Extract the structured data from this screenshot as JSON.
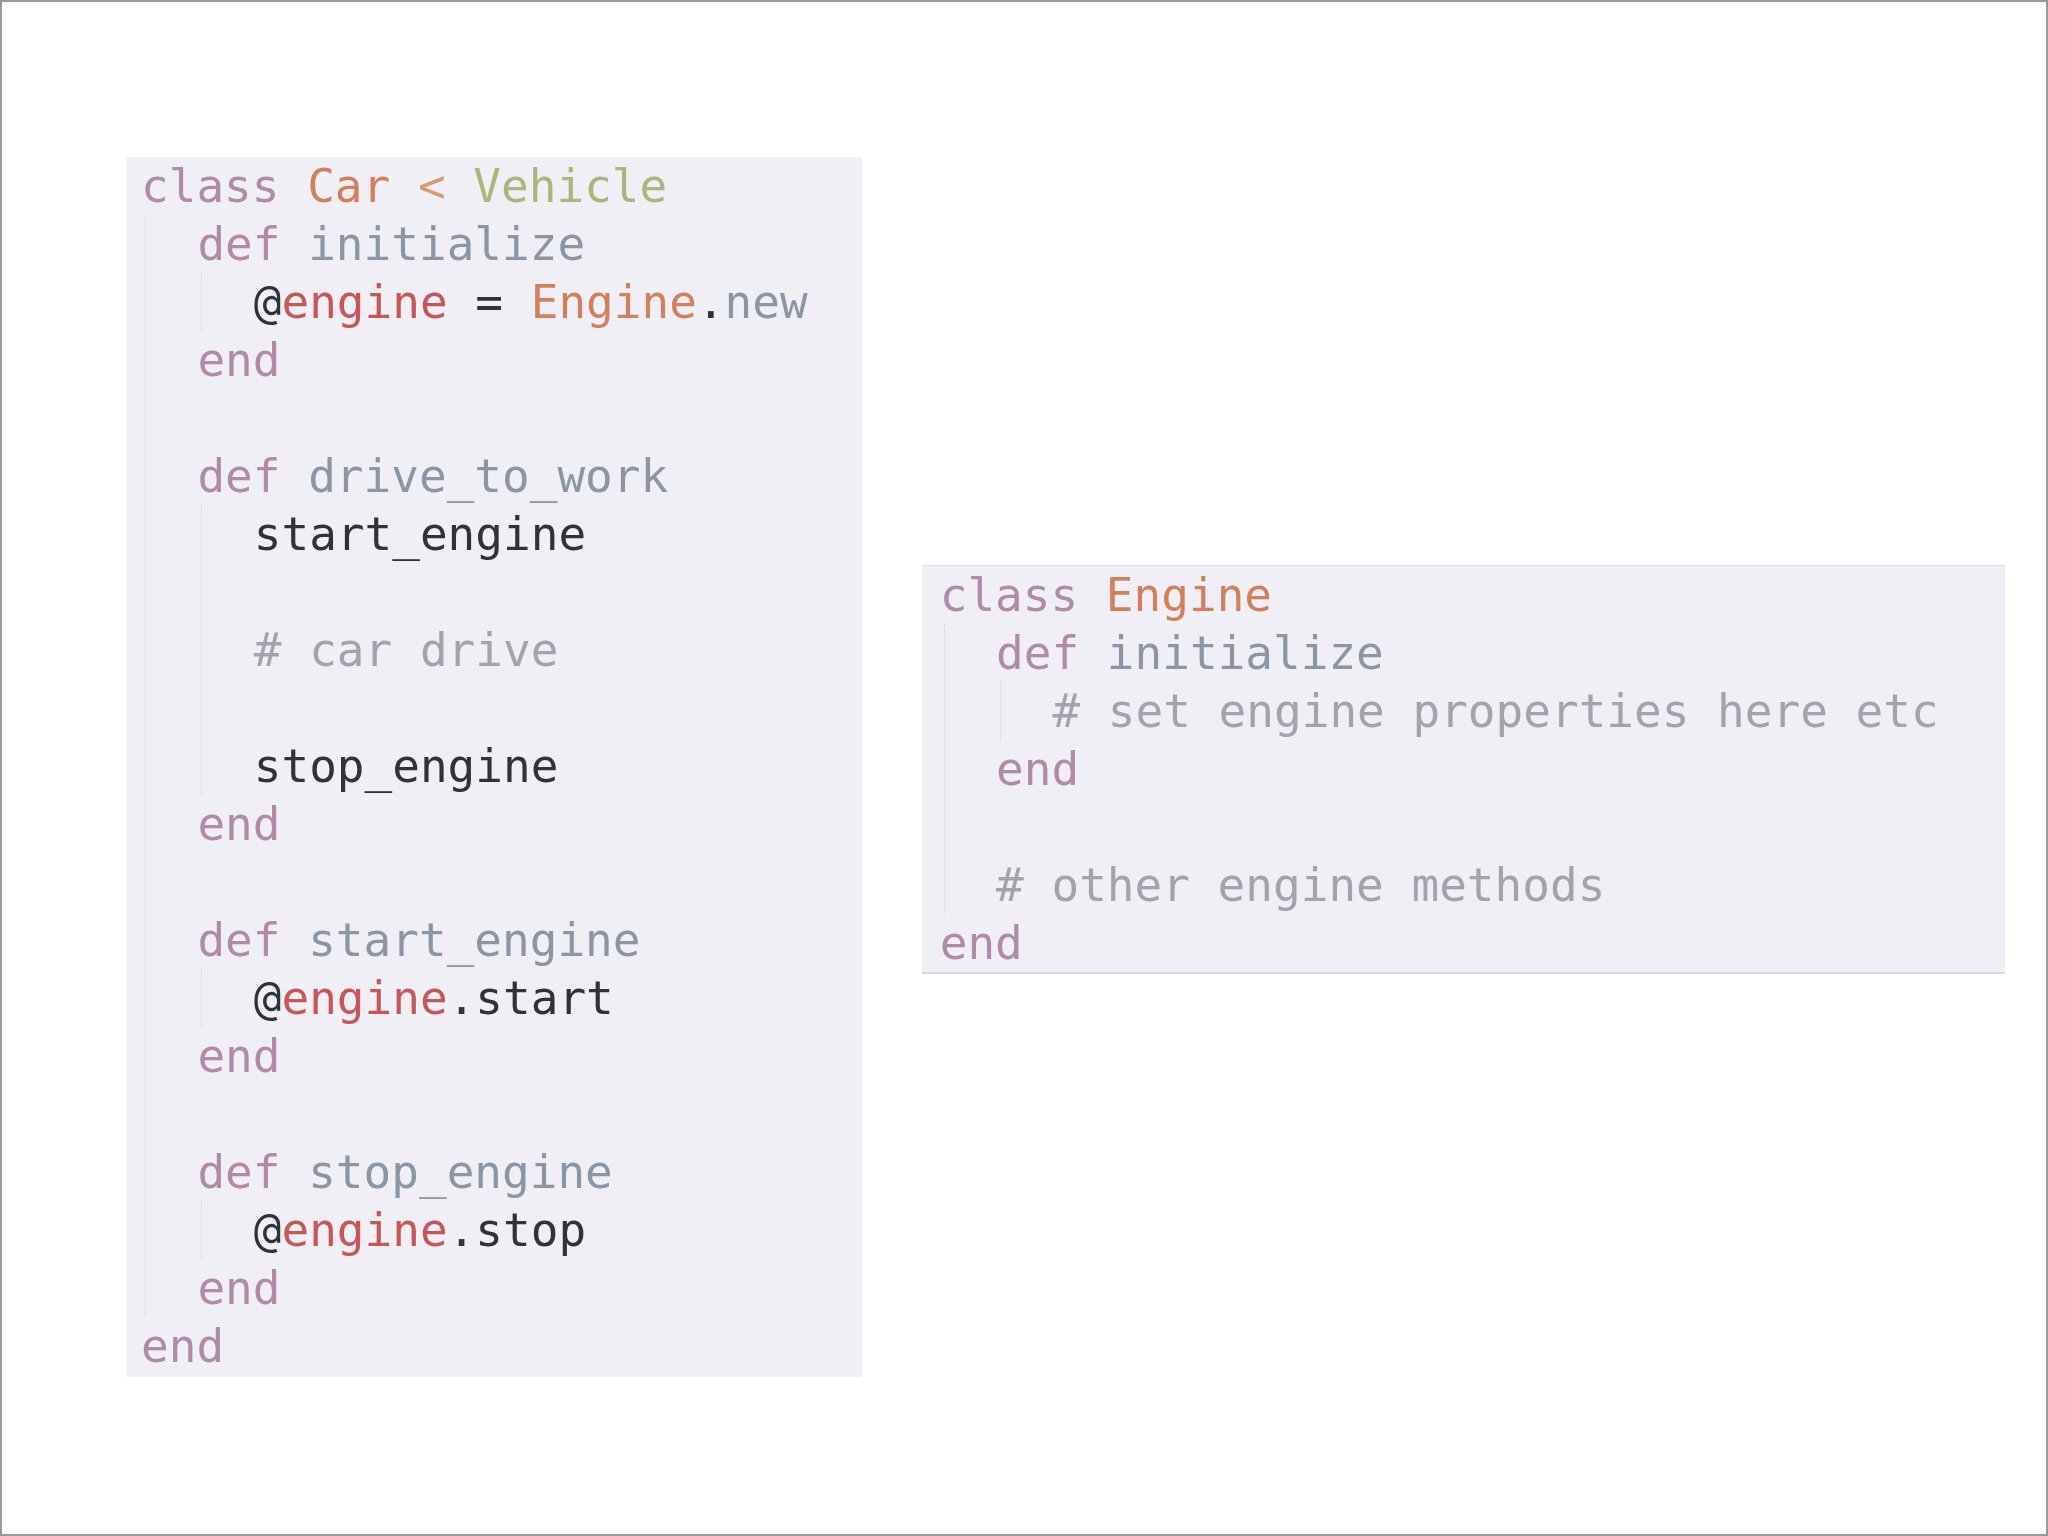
{
  "code_blocks": [
    {
      "lines": [
        {
          "tokens": [
            {
              "text": "class",
              "kind": "keyword"
            },
            {
              "text": " Car",
              "kind": "constant"
            },
            {
              "text": " < ",
              "kind": "operator"
            },
            {
              "text": "Vehicle",
              "kind": "superclass"
            }
          ],
          "children": [
            {
              "tokens": [
                {
                  "text": "def",
                  "kind": "keyword"
                },
                {
                  "text": " initialize",
                  "kind": "method"
                }
              ],
              "children": [
                {
                  "tokens": [
                    {
                      "text": "@",
                      "kind": "plain"
                    },
                    {
                      "text": "engine",
                      "kind": "ivar"
                    },
                    {
                      "text": " = ",
                      "kind": "plain"
                    },
                    {
                      "text": "Engine",
                      "kind": "constant"
                    },
                    {
                      "text": ".",
                      "kind": "plain"
                    },
                    {
                      "text": "new",
                      "kind": "method"
                    }
                  ]
                }
              ]
            },
            {
              "tokens": [
                {
                  "text": "end",
                  "kind": "keyword"
                }
              ]
            },
            {
              "kind": "blank"
            },
            {
              "tokens": [
                {
                  "text": "def",
                  "kind": "keyword"
                },
                {
                  "text": " drive_to_work",
                  "kind": "method"
                }
              ],
              "children": [
                {
                  "tokens": [
                    {
                      "text": "start_engine",
                      "kind": "plain"
                    }
                  ]
                },
                {
                  "kind": "blank"
                },
                {
                  "tokens": [
                    {
                      "text": "# car drive",
                      "kind": "comment"
                    }
                  ]
                },
                {
                  "kind": "blank"
                },
                {
                  "tokens": [
                    {
                      "text": "stop_engine",
                      "kind": "plain"
                    }
                  ]
                }
              ]
            },
            {
              "tokens": [
                {
                  "text": "end",
                  "kind": "keyword"
                }
              ]
            },
            {
              "kind": "blank"
            },
            {
              "tokens": [
                {
                  "text": "def",
                  "kind": "keyword"
                },
                {
                  "text": " start_engine",
                  "kind": "method"
                }
              ],
              "children": [
                {
                  "tokens": [
                    {
                      "text": "@",
                      "kind": "plain"
                    },
                    {
                      "text": "engine",
                      "kind": "ivar"
                    },
                    {
                      "text": ".start",
                      "kind": "plain"
                    }
                  ]
                }
              ]
            },
            {
              "tokens": [
                {
                  "text": "end",
                  "kind": "keyword"
                }
              ]
            },
            {
              "kind": "blank"
            },
            {
              "tokens": [
                {
                  "text": "def",
                  "kind": "keyword"
                },
                {
                  "text": " stop_engine",
                  "kind": "method"
                }
              ],
              "children": [
                {
                  "tokens": [
                    {
                      "text": "@",
                      "kind": "plain"
                    },
                    {
                      "text": "engine",
                      "kind": "ivar"
                    },
                    {
                      "text": ".stop",
                      "kind": "plain"
                    }
                  ]
                }
              ]
            },
            {
              "tokens": [
                {
                  "text": "end",
                  "kind": "keyword"
                }
              ]
            }
          ]
        },
        {
          "tokens": [
            {
              "text": "end",
              "kind": "keyword"
            }
          ]
        }
      ]
    },
    {
      "lines": [
        {
          "tokens": [
            {
              "text": "class",
              "kind": "keyword"
            },
            {
              "text": " Engine",
              "kind": "constant"
            }
          ],
          "children": [
            {
              "tokens": [
                {
                  "text": "def",
                  "kind": "keyword"
                },
                {
                  "text": " initialize",
                  "kind": "method"
                }
              ],
              "children": [
                {
                  "tokens": [
                    {
                      "text": "# set engine properties here etc",
                      "kind": "comment"
                    }
                  ]
                }
              ]
            },
            {
              "tokens": [
                {
                  "text": "end",
                  "kind": "keyword"
                }
              ]
            },
            {
              "kind": "blank"
            },
            {
              "tokens": [
                {
                  "text": "# other engine methods",
                  "kind": "comment"
                }
              ]
            }
          ]
        },
        {
          "tokens": [
            {
              "text": "end",
              "kind": "keyword"
            }
          ]
        }
      ]
    }
  ]
}
